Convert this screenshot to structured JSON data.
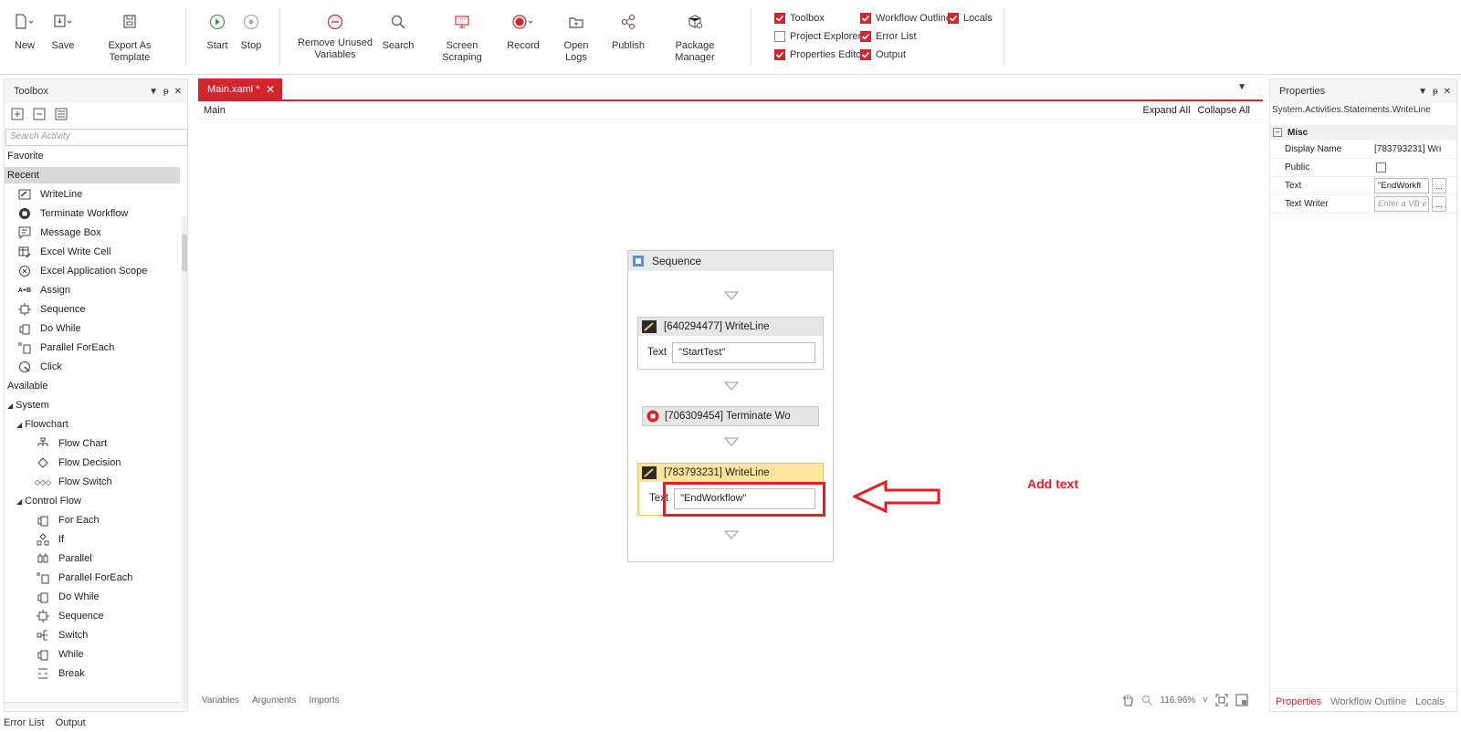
{
  "ribbon": {
    "buttons": [
      {
        "label": "New",
        "icon": "new-file-icon"
      },
      {
        "label": "Save",
        "icon": "save-icon"
      },
      {
        "label": "Export As Template",
        "icon": "export-template-icon"
      },
      {
        "label": "Start",
        "icon": "play-icon"
      },
      {
        "label": "Stop",
        "icon": "stop-icon"
      },
      {
        "label": "Remove Unused Variables",
        "icon": "remove-circle-icon"
      },
      {
        "label": "Search",
        "icon": "search-icon"
      },
      {
        "label": "Screen Scraping",
        "icon": "screen-scraping-icon"
      },
      {
        "label": "Record",
        "icon": "record-icon"
      },
      {
        "label": "Open Logs",
        "icon": "open-logs-icon"
      },
      {
        "label": "Publish",
        "icon": "publish-icon"
      },
      {
        "label": "Package Manager",
        "icon": "package-manager-icon"
      }
    ],
    "panels": [
      {
        "label": "Toolbox",
        "checked": true
      },
      {
        "label": "Workflow Outline",
        "checked": true
      },
      {
        "label": "Locals",
        "checked": true
      },
      {
        "label": "Project Explorer",
        "checked": false
      },
      {
        "label": "Error List",
        "checked": true
      },
      {
        "label": "Properties Editor",
        "checked": true
      },
      {
        "label": "Output",
        "checked": true
      }
    ]
  },
  "toolbox": {
    "title": "Toolbox",
    "search_placeholder": "Search Activity",
    "favorite": "Favorite",
    "recent": "Recent",
    "recent_items": [
      "WriteLine",
      "Terminate Workflow",
      "Message Box",
      "Excel Write Cell",
      "Excel Application Scope",
      "Assign",
      "Sequence",
      "Do While",
      "Parallel ForEach",
      "Click"
    ],
    "available": "Available",
    "system": "System",
    "flowchart": "Flowchart",
    "flowchart_items": [
      "Flow Chart",
      "Flow Decision",
      "Flow Switch"
    ],
    "control_flow": "Control Flow",
    "control_flow_items": [
      "For Each",
      "If",
      "Parallel",
      "Parallel ForEach",
      "Do While",
      "Sequence",
      "Switch",
      "While",
      "Break"
    ]
  },
  "designer": {
    "tab": "Main.xaml *",
    "breadcrumb": "Main",
    "expand_all": "Expand All",
    "collapse_all": "Collapse All",
    "sequence_title": "Sequence",
    "activities": [
      {
        "title": "[640294477] WriteLine",
        "field_label": "Text",
        "field_value": "\"StartTest\""
      },
      {
        "title": "[706309454] Terminate Wo"
      },
      {
        "title": "[783793231] WriteLine",
        "field_label": "Text",
        "field_value": "\"EndWorkflow\""
      }
    ],
    "bottom_tabs": [
      "Variables",
      "Arguments",
      "Imports"
    ],
    "zoom": "116.96%"
  },
  "annotation": {
    "text": "Add text",
    "color": "#e31e24"
  },
  "properties": {
    "title": "Properties",
    "type_name": "System.Activities.Statements.WriteLine",
    "category": "Misc",
    "rows": [
      {
        "key": "Display Name",
        "value": "[783793231] Wri"
      },
      {
        "key": "Public",
        "value": ""
      },
      {
        "key": "Text",
        "value": "\"EndWorkfl"
      },
      {
        "key": "Text Writer",
        "value": "Enter a VB e"
      }
    ],
    "bottom_tabs": [
      "Properties",
      "Workflow Outline",
      "Locals"
    ]
  },
  "bottom_bar": [
    "Error List",
    "Output"
  ],
  "colors": {
    "accent": "#d3252e",
    "annotation": "#e31e24"
  }
}
